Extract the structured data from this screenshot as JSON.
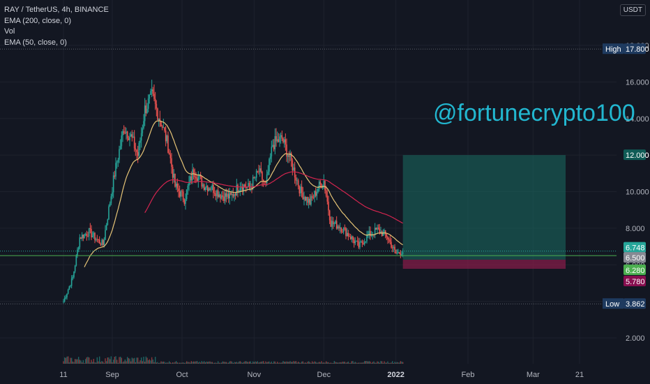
{
  "legend": {
    "symbol": "RAY / TetherUS, 4h, BINANCE",
    "ema200": "EMA (200, close, 0)",
    "vol": "Vol",
    "ema50": "EMA (50, close, 0)"
  },
  "currency": "USDT",
  "watermark": "@fortunecrypto100",
  "colors": {
    "background": "#131722",
    "up": "#26a69a",
    "down": "#ef5350",
    "ema50": "#e7c577",
    "ema200": "#d3254f",
    "profit_zone": "#1a6e63",
    "loss_zone": "#8a1d4a",
    "high_low_badge": "#1e3a5f",
    "watermark": "#22b7d0"
  },
  "chart_data": {
    "type": "candlestick",
    "ylim": [
      1.0,
      19.0
    ],
    "y_ticks": [
      "2.000",
      "4.000",
      "6.000",
      "8.000",
      "10.000",
      "12.000",
      "14.000",
      "16.000",
      "18.000"
    ],
    "x_ticks": [
      "11",
      "Sep",
      "Oct",
      "Nov",
      "Dec",
      "2022",
      "Feb",
      "Mar",
      "21"
    ],
    "price_path": {
      "dates": [
        "2021-08-11",
        "2021-08-15",
        "2021-08-18",
        "2021-08-22",
        "2021-08-26",
        "2021-08-28",
        "2021-09-02",
        "2021-09-06",
        "2021-09-09",
        "2021-09-12",
        "2021-09-15",
        "2021-09-18",
        "2021-09-22",
        "2021-09-25",
        "2021-09-28",
        "2021-10-02",
        "2021-10-06",
        "2021-10-10",
        "2021-10-14",
        "2021-10-18",
        "2021-10-22",
        "2021-10-26",
        "2021-10-30",
        "2021-11-03",
        "2021-11-06",
        "2021-11-09",
        "2021-11-13",
        "2021-11-17",
        "2021-11-21",
        "2021-11-25",
        "2021-11-29",
        "2021-12-01",
        "2021-12-04",
        "2021-12-08",
        "2021-12-12",
        "2021-12-16",
        "2021-12-20",
        "2021-12-24",
        "2021-12-28",
        "2022-01-01",
        "2022-01-04"
      ],
      "close": [
        4.0,
        5.3,
        7.5,
        7.8,
        7.3,
        7.1,
        11.0,
        13.5,
        13.0,
        12.0,
        14.5,
        15.2,
        13.8,
        12.5,
        10.3,
        9.6,
        11.2,
        10.4,
        10.2,
        9.8,
        9.7,
        10.4,
        10.2,
        11.1,
        10.3,
        12.6,
        12.9,
        11.6,
        10.0,
        9.4,
        10.3,
        10.6,
        8.3,
        8.1,
        7.6,
        7.0,
        7.6,
        7.9,
        7.6,
        6.6,
        6.75
      ]
    },
    "ema50_start_date": "2021-08-20",
    "ema200_start_date": "2021-09-15",
    "price_lines": [
      {
        "label": "",
        "value": "6.748",
        "price": 6.748,
        "color": "#26a69a"
      },
      {
        "label": "",
        "value": "6.500",
        "price": 6.5,
        "color": "#868993"
      },
      {
        "label": "",
        "value": "6.280",
        "price": 6.28,
        "color": "#4caf50"
      },
      {
        "label": "",
        "value": "5.780",
        "price": 5.78,
        "color": "#880e4f"
      },
      {
        "label": "",
        "value": "12.000",
        "price": 12.0,
        "color": "#0f5c56"
      },
      {
        "label": "High",
        "value": "17.800",
        "price": 17.8,
        "color": "#1e3a5f"
      },
      {
        "label": "Low",
        "value": "3.862",
        "price": 3.862,
        "color": "#1e3a5f"
      }
    ],
    "position": {
      "entry": 6.28,
      "stop": 5.78,
      "target": 12.0,
      "start_date": "2022-01-04",
      "end_date": "2022-03-15"
    }
  }
}
